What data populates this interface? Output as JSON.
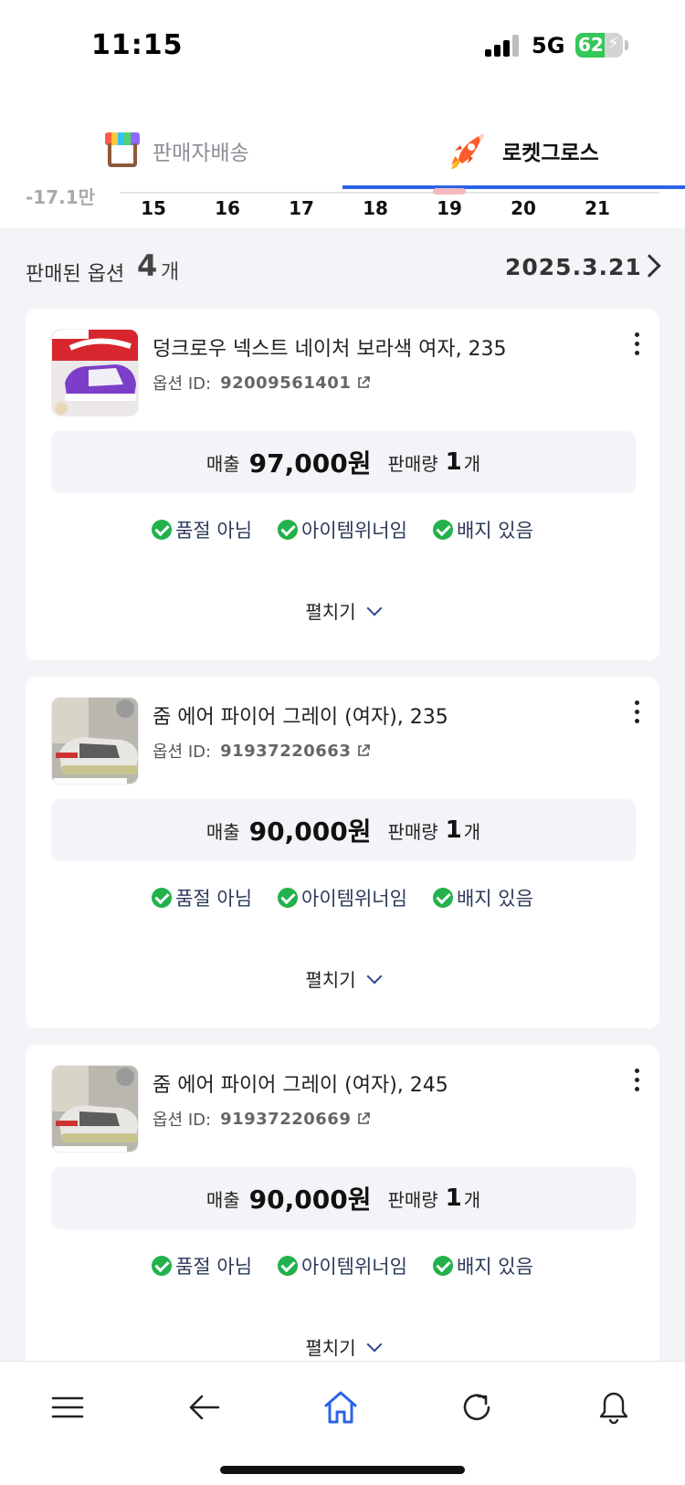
{
  "status": {
    "time": "11:15",
    "network": "5G",
    "battery": "62",
    "battery_level": 0.62
  },
  "tabs": [
    {
      "label": "판매자배송",
      "icon": "store-icon",
      "active": false
    },
    {
      "label": "로켓그로스",
      "icon": "rocket-icon",
      "active": true
    }
  ],
  "date_strip": {
    "cut_label": "-17.1만",
    "days": [
      "15",
      "16",
      "17",
      "18",
      "19",
      "20",
      "21"
    ]
  },
  "summary": {
    "label": "판매된 옵션",
    "count": "4",
    "unit": "개",
    "date": "2025.3.21"
  },
  "products": [
    {
      "name": "덩크로우 넥스트 네이처 보라색 여자, 235",
      "option_label": "옵션 ID:",
      "option_id": "92009561401",
      "sales_label": "매출",
      "sales": "97,000원",
      "qty_label": "판매량",
      "qty": "1",
      "qty_unit": "개",
      "badges": [
        "품절 아님",
        "아이템위너임",
        "배지 있음"
      ],
      "expand_label": "펼치기",
      "thumb": "purple-sneaker-photo"
    },
    {
      "name": "줌 에어 파이어 그레이 (여자), 235",
      "option_label": "옵션 ID:",
      "option_id": "91937220663",
      "sales_label": "매출",
      "sales": "90,000원",
      "qty_label": "판매량",
      "qty": "1",
      "qty_unit": "개",
      "badges": [
        "품절 아님",
        "아이템위너임",
        "배지 있음"
      ],
      "expand_label": "펼치기",
      "thumb": "grey-sneaker-photo"
    },
    {
      "name": "줌 에어 파이어 그레이 (여자), 245",
      "option_label": "옵션 ID:",
      "option_id": "91937220669",
      "sales_label": "매출",
      "sales": "90,000원",
      "qty_label": "판매량",
      "qty": "1",
      "qty_unit": "개",
      "badges": [
        "품절 아님",
        "아이템위너임",
        "배지 있음"
      ],
      "expand_label": "펼치기",
      "thumb": "grey-sneaker-photo"
    }
  ],
  "nav": [
    "menu-icon",
    "back-icon",
    "home-icon",
    "refresh-icon",
    "bell-icon"
  ],
  "colors": {
    "accent": "#2b63e6",
    "check": "#22b14c",
    "badge_text": "#2a3a5a"
  }
}
